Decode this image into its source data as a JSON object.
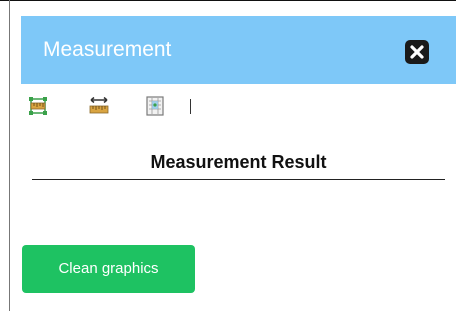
{
  "panel": {
    "title": "Measurement",
    "header_color": "#7ec8f8",
    "close_icon": "close-icon"
  },
  "toolbar": {
    "tools": [
      {
        "name": "area-measure",
        "icon": "ruler-area-icon"
      },
      {
        "name": "distance-measure",
        "icon": "ruler-distance-icon"
      },
      {
        "name": "location-measure",
        "icon": "location-icon"
      }
    ]
  },
  "result": {
    "title": "Measurement Result"
  },
  "actions": {
    "clean_label": "Clean graphics",
    "clean_color": "#1ec262"
  }
}
